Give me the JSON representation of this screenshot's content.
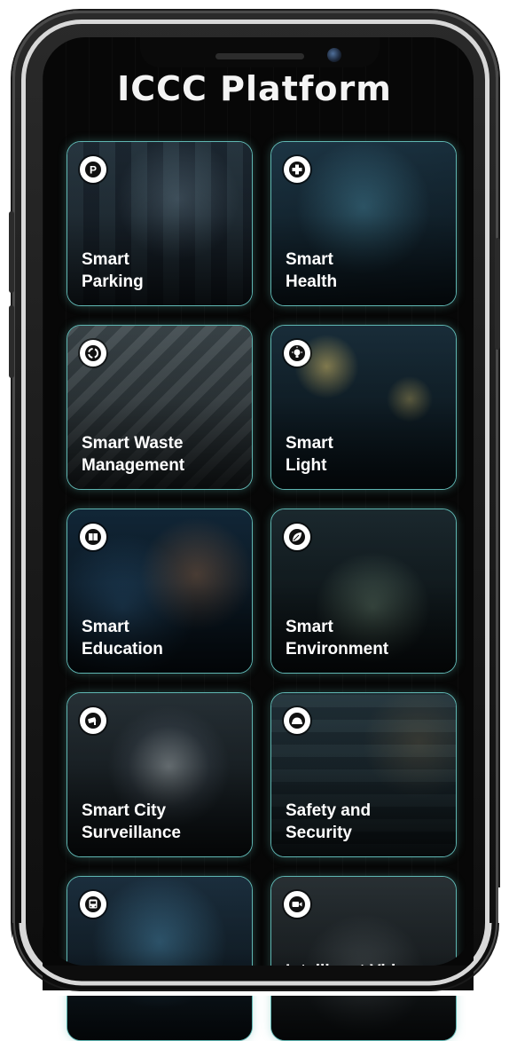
{
  "app": {
    "title": "ICCC Platform"
  },
  "cards": [
    {
      "label": "Smart\nParking",
      "icon": "parking-icon"
    },
    {
      "label": "Smart\nHealth",
      "icon": "medical-cross-icon"
    },
    {
      "label": "Smart Waste\nManagement",
      "icon": "recycle-icon"
    },
    {
      "label": "Smart\nLight",
      "icon": "lightbulb-icon"
    },
    {
      "label": "Smart\nEducation",
      "icon": "book-icon"
    },
    {
      "label": "Smart\nEnvironment",
      "icon": "leaf-icon"
    },
    {
      "label": "Smart City\nSurveillance",
      "icon": "cctv-camera-icon"
    },
    {
      "label": "Safety and\nSecurity",
      "icon": "helmet-icon"
    },
    {
      "label": "",
      "icon": "bus-icon"
    },
    {
      "label": "Intelligent Video",
      "icon": "video-camera-icon"
    }
  ],
  "colors": {
    "card_border": "#5fb6b2",
    "background": "#070707",
    "title": "#f4f4f4"
  }
}
